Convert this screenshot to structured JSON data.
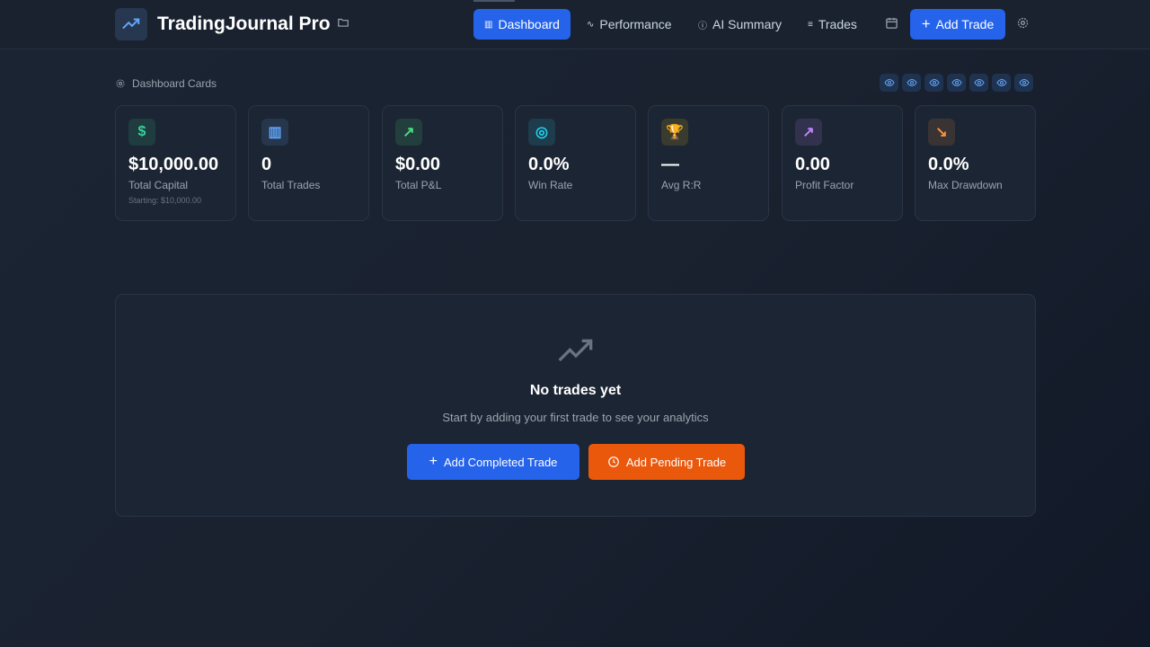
{
  "header": {
    "title": "TradingJournal Pro",
    "nav": [
      {
        "label": "Dashboard",
        "icon": "bar-chart-icon",
        "active": true
      },
      {
        "label": "Performance",
        "icon": "activity-icon"
      },
      {
        "label": "AI Summary",
        "icon": "info-icon"
      },
      {
        "label": "Trades",
        "icon": "list-icon"
      }
    ],
    "add_trade": "Add Trade"
  },
  "dashboard_cards_label": "Dashboard Cards",
  "cards": [
    {
      "value": "$10,000.00",
      "label": "Total Capital",
      "sub": "Starting: $10,000.00",
      "icon": "dollar-icon",
      "color": "#34d399"
    },
    {
      "value": "0",
      "label": "Total Trades",
      "icon": "bar-chart-icon",
      "color": "#60a5fa"
    },
    {
      "value": "$0.00",
      "label": "Total P&L",
      "icon": "trending-up-icon",
      "color": "#4ade80"
    },
    {
      "value": "0.0%",
      "label": "Win Rate",
      "icon": "target-icon",
      "color": "#22d3ee"
    },
    {
      "value": "—",
      "label": "Avg R:R",
      "icon": "trophy-icon",
      "color": "#facc15"
    },
    {
      "value": "0.00",
      "label": "Profit Factor",
      "icon": "trending-up-icon",
      "color": "#c084fc"
    },
    {
      "value": "0.0%",
      "label": "Max Drawdown",
      "icon": "trending-down-icon",
      "color": "#fb923c"
    }
  ],
  "empty": {
    "title": "No trades yet",
    "subtitle": "Start by adding your first trade to see your analytics",
    "add_completed": "Add Completed Trade",
    "add_pending": "Add Pending Trade"
  },
  "colors": {
    "accent": "#2563eb",
    "pending": "#ea580c"
  }
}
